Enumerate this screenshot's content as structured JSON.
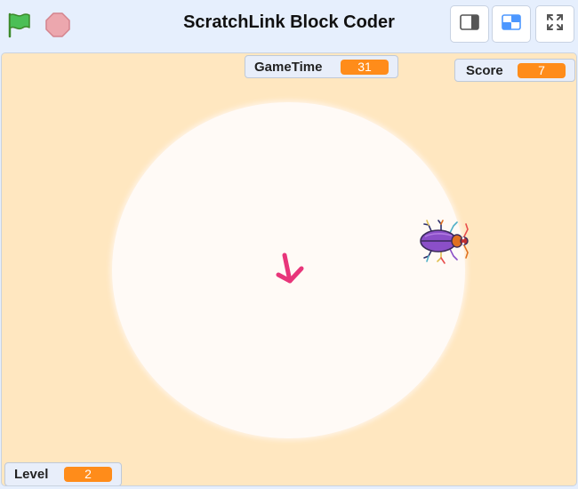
{
  "app": {
    "title": "ScratchLink Block Coder"
  },
  "controls": {
    "green_flag_icon": "green-flag-icon",
    "stop_icon": "stop-sign-icon"
  },
  "layout_modes": [
    {
      "name": "small-stage-icon"
    },
    {
      "name": "normal-stage-icon"
    },
    {
      "name": "fullscreen-icon"
    }
  ],
  "monitors": {
    "gametime": {
      "label": "GameTime",
      "value": "31"
    },
    "score": {
      "label": "Score",
      "value": "7"
    },
    "level": {
      "label": "Level",
      "value": "2"
    }
  },
  "sprites": {
    "beetle": "beetle-sprite",
    "arrow": "arrow-sprite"
  },
  "colors": {
    "stage_background": "#ffe7c0",
    "monitor_value": "#ff8c1a",
    "arrow": "#e8357a",
    "beetle_body": "#8b4fc8"
  }
}
